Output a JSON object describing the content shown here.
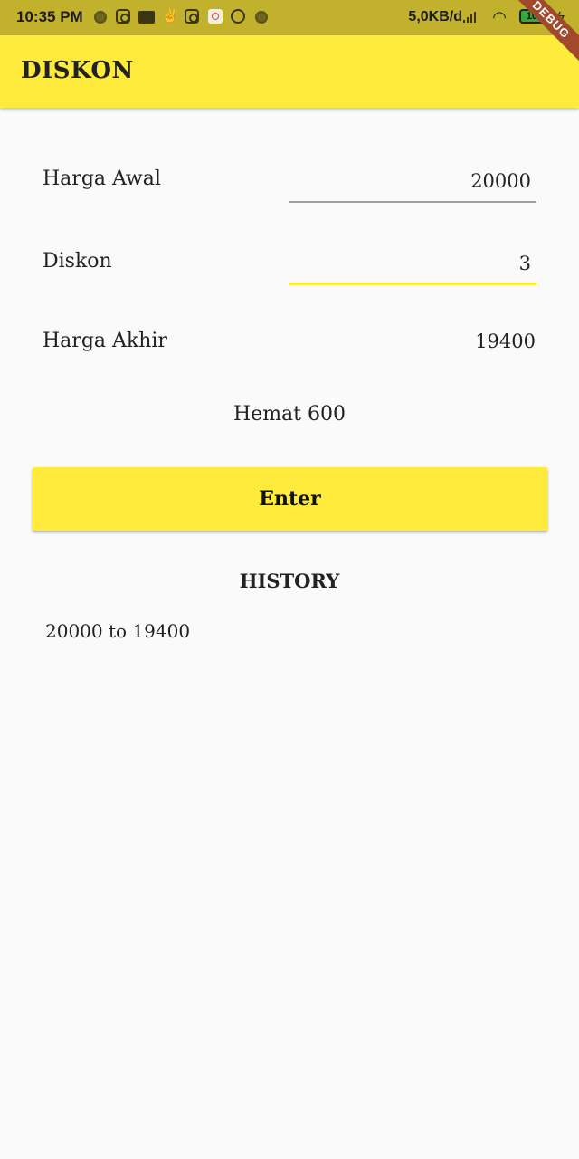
{
  "status_bar": {
    "time": "10:35 PM",
    "net_speed": "5,0KB/d",
    "battery": "100",
    "debug_banner": "DEBUG",
    "icons": [
      "dot-icon",
      "instagram-icon",
      "notification-icon",
      "hand-icon",
      "instagram-icon",
      "app-icon",
      "whatsapp-icon",
      "dot-icon",
      "signal-icon",
      "wifi-icon",
      "battery-icon",
      "charging-icon"
    ]
  },
  "app_bar": {
    "title": "DISKON",
    "color": "#ffeb3b"
  },
  "form": {
    "harga_awal_label": "Harga Awal",
    "harga_awal_value": "20000",
    "diskon_label": "Diskon",
    "diskon_value": "3",
    "harga_akhir_label": "Harga Akhir",
    "harga_akhir_value": "19400"
  },
  "hemat": "Hemat 600",
  "enter_button": {
    "label": "Enter",
    "color": "#ffeb3b"
  },
  "history": {
    "title": "HISTORY",
    "items": [
      "20000 to 19400"
    ]
  }
}
